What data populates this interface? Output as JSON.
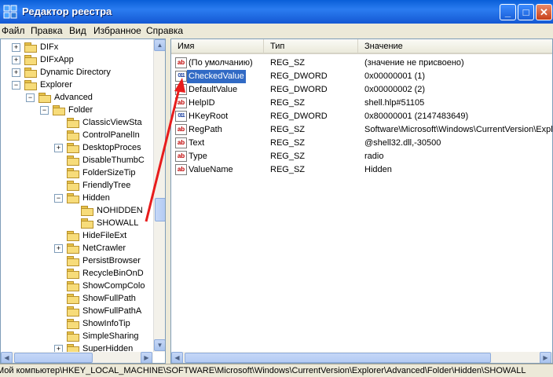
{
  "window": {
    "title": "Редактор реестра"
  },
  "menu": {
    "file": "Файл",
    "edit": "Правка",
    "view": "Вид",
    "favorites": "Избранное",
    "help": "Справка"
  },
  "tree": {
    "items": [
      {
        "label": "DIFx",
        "expander": "+"
      },
      {
        "label": "DIFxApp",
        "expander": "+"
      },
      {
        "label": "Dynamic Directory",
        "expander": "+"
      },
      {
        "label": "Explorer",
        "expander": "−"
      },
      {
        "label": "Advanced",
        "expander": "−"
      },
      {
        "label": "Folder",
        "expander": "−"
      },
      {
        "label": "ClassicViewSta",
        "expander": ""
      },
      {
        "label": "ControlPanelIn",
        "expander": ""
      },
      {
        "label": "DesktopProces",
        "expander": "+"
      },
      {
        "label": "DisableThumbC",
        "expander": ""
      },
      {
        "label": "FolderSizeTip",
        "expander": ""
      },
      {
        "label": "FriendlyTree",
        "expander": ""
      },
      {
        "label": "Hidden",
        "expander": "−"
      },
      {
        "label": "NOHIDDEN",
        "expander": ""
      },
      {
        "label": "SHOWALL",
        "expander": ""
      },
      {
        "label": "HideFileExt",
        "expander": ""
      },
      {
        "label": "NetCrawler",
        "expander": "+"
      },
      {
        "label": "PersistBrowser",
        "expander": ""
      },
      {
        "label": "RecycleBinOnD",
        "expander": ""
      },
      {
        "label": "ShowCompColo",
        "expander": ""
      },
      {
        "label": "ShowFullPath",
        "expander": ""
      },
      {
        "label": "ShowFullPathA",
        "expander": ""
      },
      {
        "label": "ShowInfoTip",
        "expander": ""
      },
      {
        "label": "SimpleSharing",
        "expander": ""
      },
      {
        "label": "SuperHidden",
        "expander": "+"
      }
    ]
  },
  "list": {
    "headers": {
      "name": "Имя",
      "type": "Тип",
      "value": "Значение"
    },
    "rows": [
      {
        "name": "(По умолчанию)",
        "type": "REG_SZ",
        "value": "(значение не присвоено)",
        "icon": "ab"
      },
      {
        "name": "CheckedValue",
        "type": "REG_DWORD",
        "value": "0x00000001 (1)",
        "icon": "011"
      },
      {
        "name": "DefaultValue",
        "type": "REG_DWORD",
        "value": "0x00000002 (2)",
        "icon": "011"
      },
      {
        "name": "HelpID",
        "type": "REG_SZ",
        "value": "shell.hlp#51105",
        "icon": "ab"
      },
      {
        "name": "HKeyRoot",
        "type": "REG_DWORD",
        "value": "0x80000001 (2147483649)",
        "icon": "011"
      },
      {
        "name": "RegPath",
        "type": "REG_SZ",
        "value": "Software\\Microsoft\\Windows\\CurrentVersion\\Explo",
        "icon": "ab"
      },
      {
        "name": "Text",
        "type": "REG_SZ",
        "value": "@shell32.dll,-30500",
        "icon": "ab"
      },
      {
        "name": "Type",
        "type": "REG_SZ",
        "value": "radio",
        "icon": "ab"
      },
      {
        "name": "ValueName",
        "type": "REG_SZ",
        "value": "Hidden",
        "icon": "ab"
      }
    ]
  },
  "status": {
    "path": "Мой компьютер\\HKEY_LOCAL_MACHINE\\SOFTWARE\\Microsoft\\Windows\\CurrentVersion\\Explorer\\Advanced\\Folder\\Hidden\\SHOWALL"
  },
  "colors": {
    "titlebar": "#0a5fd8",
    "selection": "#316ac5",
    "annotation_arrow": "#e81c1c"
  }
}
